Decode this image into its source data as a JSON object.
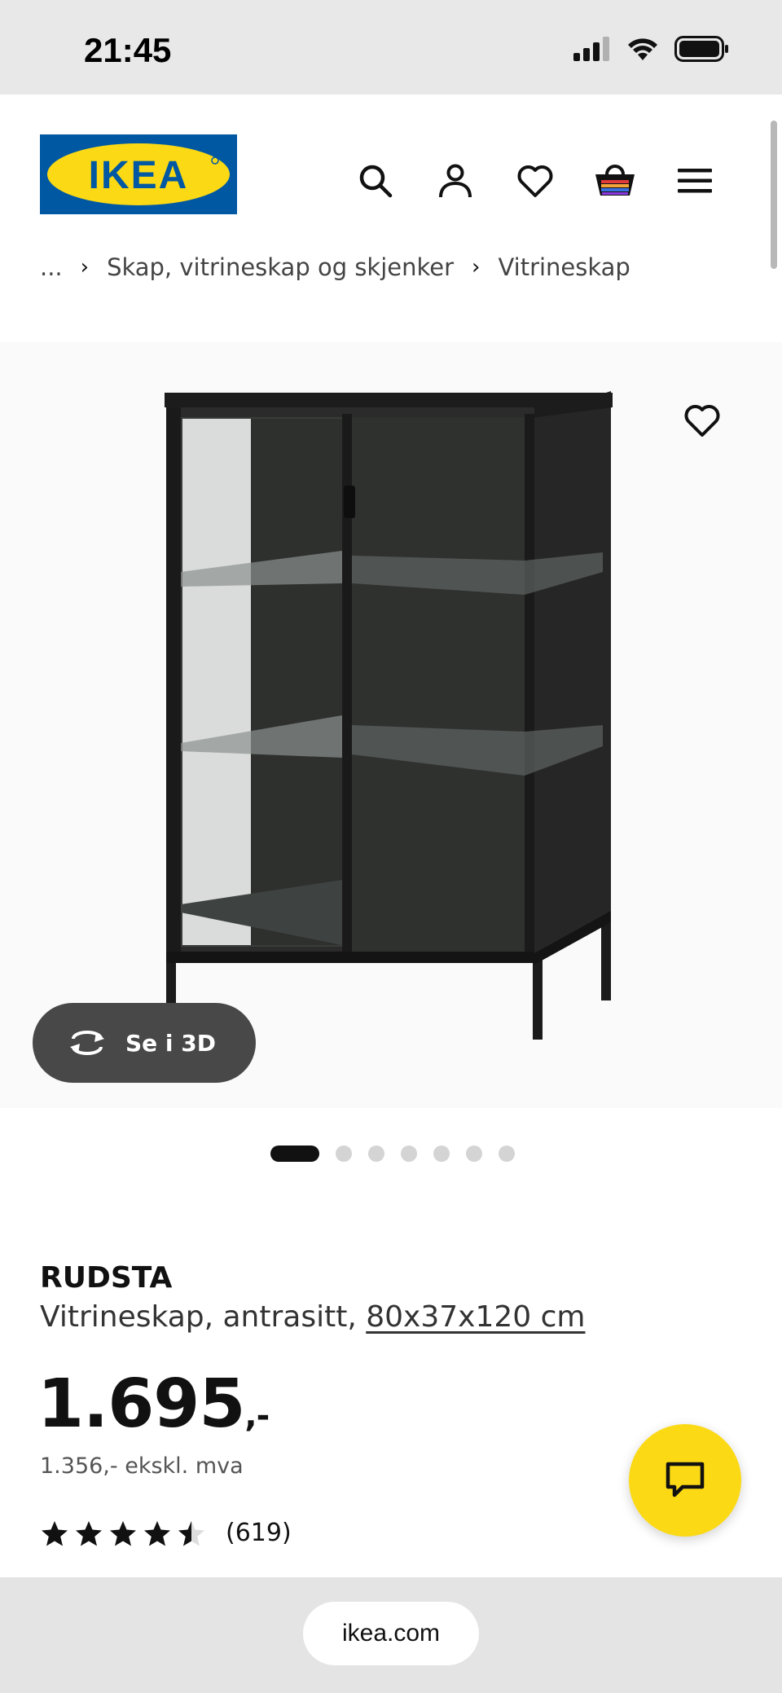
{
  "status_bar": {
    "time": "21:45"
  },
  "header": {
    "logo_text": "IKEA"
  },
  "breadcrumb": {
    "ellipsis": "...",
    "items": [
      "Skap, vitrineskap og skjenker",
      "Vitrineskap"
    ]
  },
  "gallery": {
    "view_3d_label": "Se i 3D",
    "image_count": 7,
    "active_index": 0
  },
  "product": {
    "name": "RUDSTA",
    "description": "Vitrineskap, antrasitt,",
    "size": "80x37x120 cm",
    "price": "1.695",
    "price_suffix": ",-",
    "price_ex_vat": "1.356,- ekskl. mva",
    "rating": 4.5,
    "review_count": "(619)"
  },
  "browser": {
    "url": "ikea.com"
  },
  "colors": {
    "ikea_blue": "#0058a3",
    "ikea_yellow": "#fbd914"
  }
}
